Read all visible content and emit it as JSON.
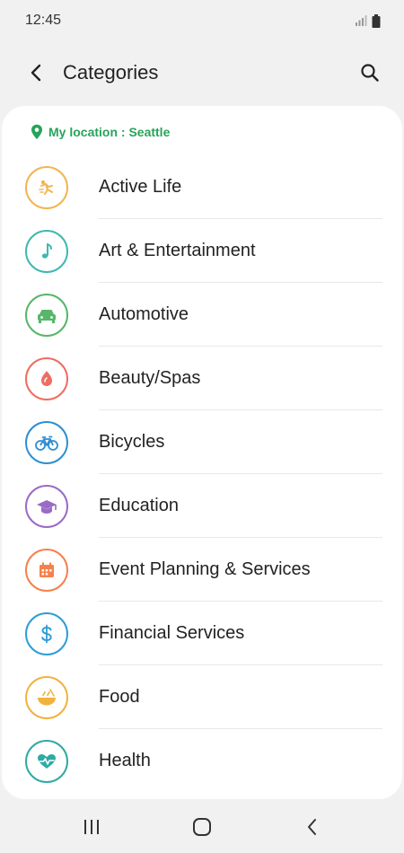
{
  "status_bar": {
    "time": "12:45",
    "icons": [
      "signal-icon",
      "battery-icon"
    ]
  },
  "header": {
    "title": "Categories",
    "back_icon": "back-arrow-icon",
    "search_icon": "search-icon"
  },
  "location": {
    "text": "My location : Seattle",
    "color": "#27a35a"
  },
  "categories": [
    {
      "label": "Active Life",
      "icon": "running-icon",
      "color": "#f2b552"
    },
    {
      "label": "Art & Entertainment",
      "icon": "music-note-icon",
      "color": "#3fb8b2"
    },
    {
      "label": "Automotive",
      "icon": "car-icon",
      "color": "#57b66a"
    },
    {
      "label": "Beauty/Spas",
      "icon": "flame-drop-icon",
      "color": "#ee6d62"
    },
    {
      "label": "Bicycles",
      "icon": "bicycle-icon",
      "color": "#2e8fd1"
    },
    {
      "label": "Education",
      "icon": "graduation-cap-icon",
      "color": "#9a6bc6"
    },
    {
      "label": "Event Planning & Services",
      "icon": "calendar-icon",
      "color": "#f5814c"
    },
    {
      "label": "Financial Services",
      "icon": "dollar-icon",
      "color": "#2f9dd6"
    },
    {
      "label": "Food",
      "icon": "food-bowl-icon",
      "color": "#f2b23e"
    },
    {
      "label": "Health",
      "icon": "heart-pulse-icon",
      "color": "#2faaa4"
    }
  ],
  "nav_bar": {
    "recents_icon": "recents-icon",
    "home_icon": "home-icon",
    "back_icon": "nav-back-icon"
  }
}
